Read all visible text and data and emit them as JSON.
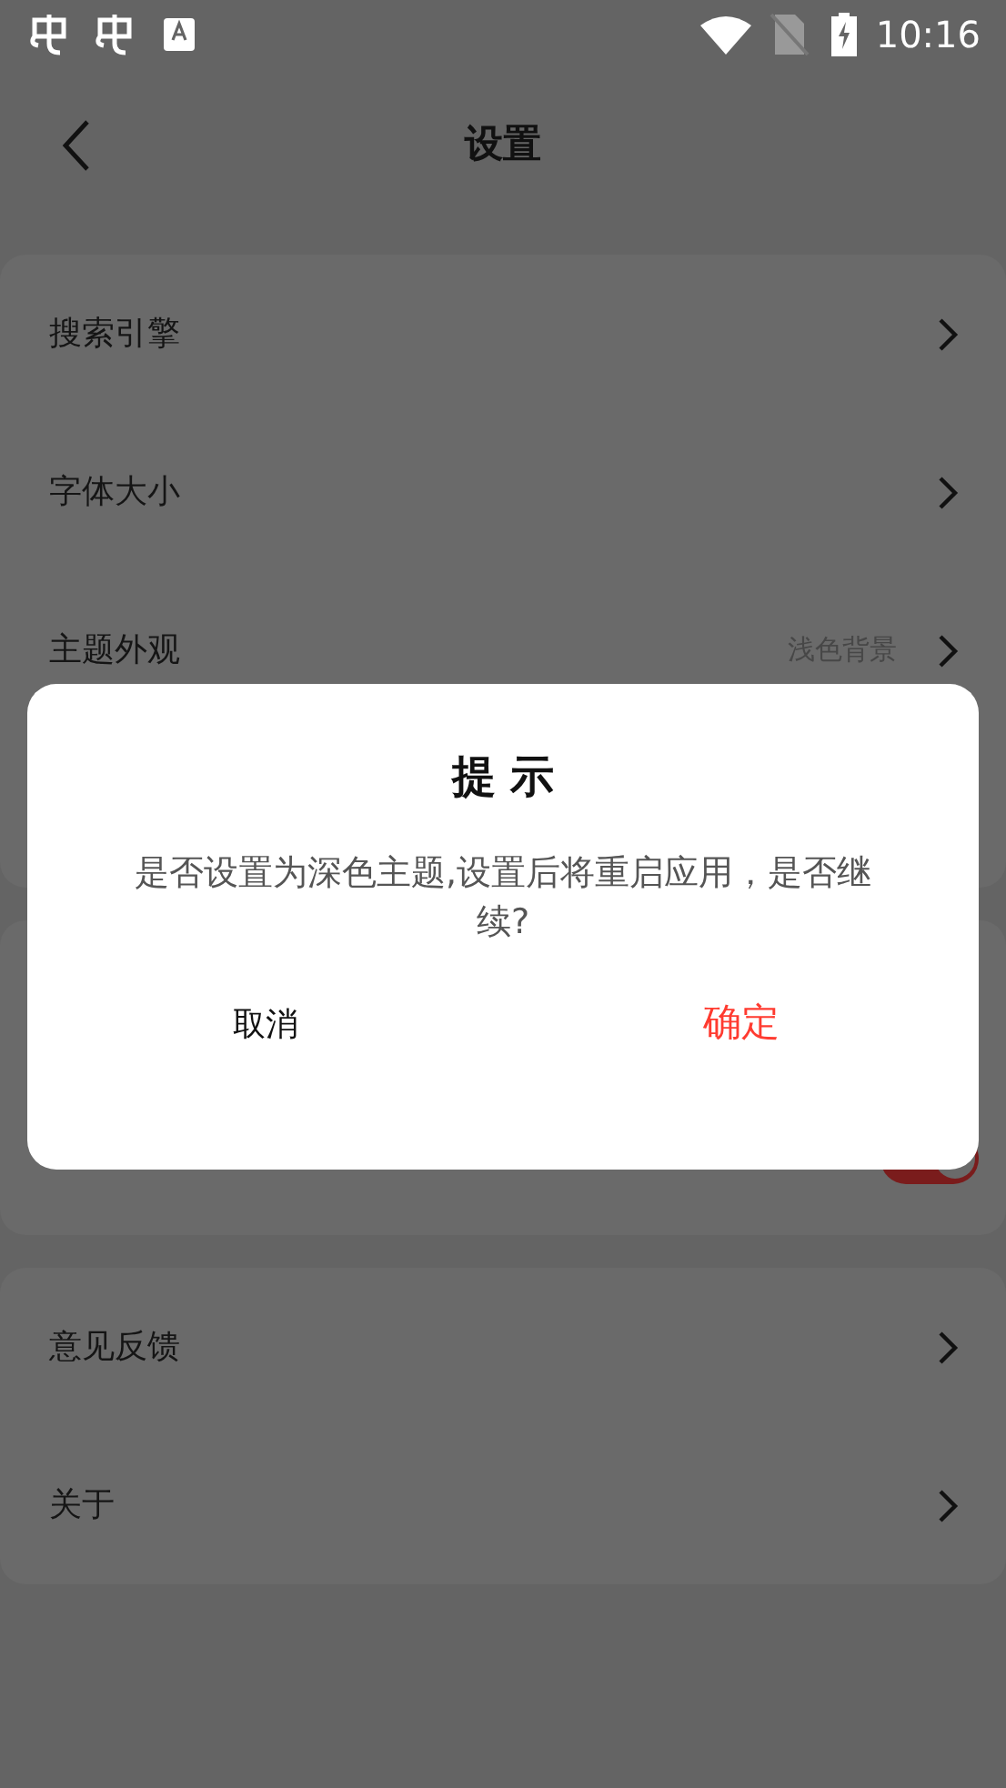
{
  "status_bar": {
    "time": "10:16"
  },
  "header": {
    "title": "设置"
  },
  "groups": [
    {
      "rows": [
        {
          "kind": "link",
          "label": "搜索引擎"
        },
        {
          "kind": "link",
          "label": "字体大小"
        },
        {
          "kind": "link",
          "label": "主题外观",
          "value": "浅色背景"
        }
      ]
    },
    {
      "rows": [
        {
          "kind": "toggle",
          "on": true
        }
      ]
    },
    {
      "rows": [
        {
          "kind": "link",
          "label": "意见反馈"
        },
        {
          "kind": "link",
          "label": "关于"
        }
      ]
    }
  ],
  "dialog": {
    "title": "提 示",
    "message": "是否设置为深色主题,设置后将重启应用，是否继续?",
    "buttons": [
      {
        "label": "取消",
        "kind": "cancel"
      },
      {
        "label": "确定",
        "kind": "confirm"
      }
    ]
  }
}
